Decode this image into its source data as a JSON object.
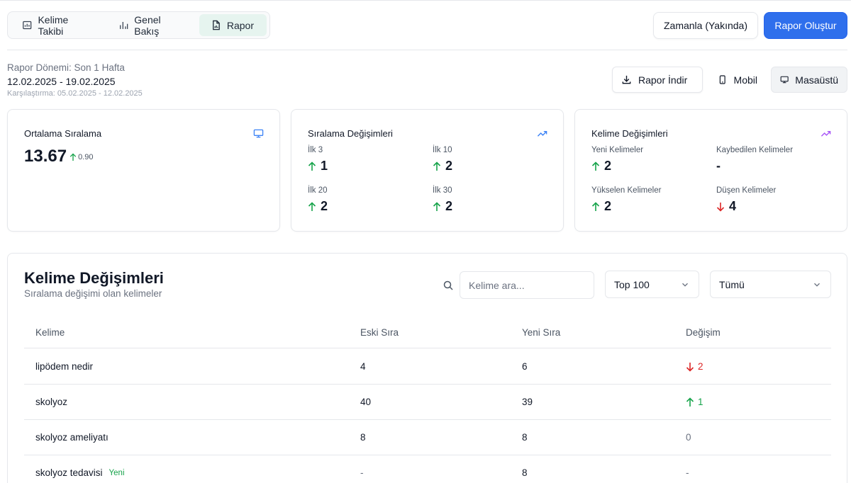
{
  "tabs": [
    {
      "label": "Kelime Takibi",
      "icon": "bar-chart-icon"
    },
    {
      "label": "Genel Bakış",
      "icon": "column-chart-icon"
    },
    {
      "label": "Rapor",
      "icon": "file-chart-icon"
    }
  ],
  "header": {
    "schedule_label": "Zamanla (Yakında)",
    "create_report_label": "Rapor Oluştur"
  },
  "period": {
    "label": "Rapor Dönemi: Son 1 Hafta",
    "range": "12.02.2025 - 19.02.2025",
    "comparison": "Karşılaştırma: 05.02.2025 - 12.02.2025"
  },
  "devices": {
    "download_label": "Rapor İndir",
    "mobile_label": "Mobil",
    "desktop_label": "Masaüstü",
    "selected": "Masaüstü"
  },
  "cards": {
    "average": {
      "title": "Ortalama Sıralama",
      "value": "13.67",
      "delta": "0.90"
    },
    "ranking": {
      "title": "Sıralama Değişimleri",
      "metrics": [
        {
          "label": "İlk 3",
          "value": "1",
          "dir": "up"
        },
        {
          "label": "İlk 10",
          "value": "2",
          "dir": "up"
        },
        {
          "label": "İlk 20",
          "value": "2",
          "dir": "up"
        },
        {
          "label": "İlk 30",
          "value": "2",
          "dir": "up"
        }
      ]
    },
    "keywords": {
      "title": "Kelime Değişimleri",
      "metrics": [
        {
          "label": "Yeni Kelimeler",
          "value": "2",
          "dir": "up"
        },
        {
          "label": "Kaybedilen Kelimeler",
          "value": "-",
          "dir": "none"
        },
        {
          "label": "Yükselen Kelimeler",
          "value": "2",
          "dir": "up"
        },
        {
          "label": "Düşen Kelimeler",
          "value": "4",
          "dir": "down"
        }
      ]
    }
  },
  "table": {
    "title": "Kelime Değişimleri",
    "subtitle": "Sıralama değişimi olan kelimeler",
    "search_placeholder": "Kelime ara...",
    "limit_select": "Top 100",
    "filter_select": "Tümü",
    "columns": [
      "Kelime",
      "Eski Sıra",
      "Yeni Sıra",
      "Değişim"
    ],
    "rows": [
      {
        "keyword": "lipödem nedir",
        "badge": "",
        "old": "4",
        "new": "6",
        "change": "2",
        "dir": "down"
      },
      {
        "keyword": "skolyoz",
        "badge": "",
        "old": "40",
        "new": "39",
        "change": "1",
        "dir": "up"
      },
      {
        "keyword": "skolyoz ameliyatı",
        "badge": "",
        "old": "8",
        "new": "8",
        "change": "0",
        "dir": "none"
      },
      {
        "keyword": "skolyoz tedavisi",
        "badge": "Yeni",
        "old": "-",
        "new": "8",
        "change": "-",
        "dir": "none"
      }
    ]
  },
  "colors": {
    "primary": "#2f6fec",
    "up": "#16a34a",
    "down": "#dc2626",
    "active_tab": "#e6f4ef",
    "ranking_icon": "#3b82f6",
    "keyword_icon": "#a855f7"
  }
}
